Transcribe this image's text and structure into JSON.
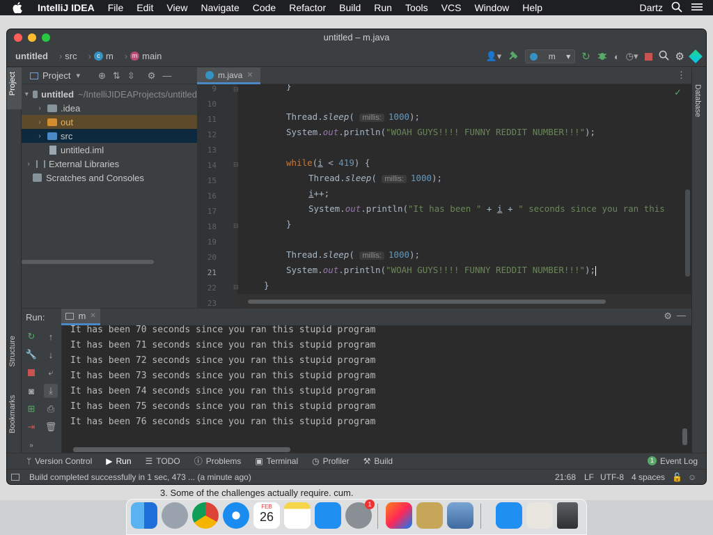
{
  "menubar": {
    "app_name": "IntelliJ IDEA",
    "items": [
      "File",
      "Edit",
      "View",
      "Navigate",
      "Code",
      "Refactor",
      "Build",
      "Run",
      "Tools",
      "VCS",
      "Window",
      "Help"
    ],
    "user": "Dartz"
  },
  "window": {
    "title": "untitled – m.java"
  },
  "navbar": {
    "crumbs": [
      "untitled",
      "src",
      "m",
      "main"
    ],
    "run_config": "m"
  },
  "left_strip": {
    "project": "Project",
    "structure": "Structure",
    "bookmarks": "Bookmarks"
  },
  "right_strip": {
    "database": "Database"
  },
  "project_panel": {
    "header": "Project",
    "tree": [
      {
        "label": "untitled",
        "path": "~/IntelliJIDEAProjects/untitled"
      },
      {
        "label": ".idea"
      },
      {
        "label": "out"
      },
      {
        "label": "src"
      },
      {
        "label": "untitled.iml"
      },
      {
        "label": "External Libraries"
      },
      {
        "label": "Scratches and Consoles"
      }
    ]
  },
  "editor": {
    "tab": "m.java",
    "line_numbers": [
      "9",
      "10",
      "11",
      "12",
      "13",
      "14",
      "15",
      "16",
      "17",
      "18",
      "19",
      "20",
      "21",
      "22",
      "23"
    ],
    "hint_label": "millis:",
    "sleep_value": "1000",
    "loop_limit": "419",
    "str_funny": "\"WOAH GUYS!!!! FUNNY REDDIT NUMBER!!!\"",
    "str_been": "\"It has been \"",
    "str_seconds": "\" seconds since you ran this",
    "kw_while": "while",
    "var_i": "i",
    "class_thread": "Thread",
    "method_sleep": "sleep",
    "class_system": "System",
    "field_out": "out",
    "method_println": "println"
  },
  "run_panel": {
    "label": "Run:",
    "tab": "m",
    "output": [
      "It has been 70 seconds since you ran this stupid program",
      "It has been 71 seconds since you ran this stupid program",
      "It has been 72 seconds since you ran this stupid program",
      "It has been 73 seconds since you ran this stupid program",
      "It has been 74 seconds since you ran this stupid program",
      "It has been 75 seconds since you ran this stupid program",
      "It has been 76 seconds since you ran this stupid program"
    ]
  },
  "tool_windows": [
    "Version Control",
    "Run",
    "TODO",
    "Problems",
    "Terminal",
    "Profiler",
    "Build"
  ],
  "event_log": {
    "label": "Event Log",
    "count": "1"
  },
  "status": {
    "message": "Build completed successfully in 1 sec, 473 ... (a minute ago)",
    "position": "21:68",
    "line_sep": "LF",
    "encoding": "UTF-8",
    "indent": "4 spaces"
  },
  "background_text": "3. Some of the challenges actually require. cum.",
  "dock": {
    "calendar_month": "FEB",
    "calendar_day": "26",
    "badge": "1"
  },
  "colors": {
    "accent": "#4a88c7",
    "keyword": "#cc7832",
    "number": "#6897bb",
    "string": "#6a8759",
    "field": "#9876aa",
    "console_bg": "#2b2b2b",
    "panel_bg": "#3c3f41"
  }
}
